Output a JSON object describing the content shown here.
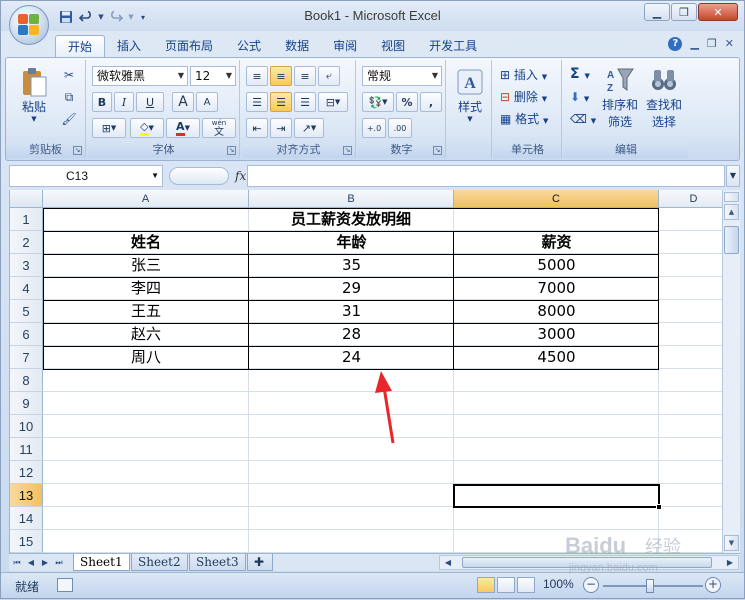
{
  "window": {
    "title": "Book1 - Microsoft Excel"
  },
  "ribbon_tabs": [
    {
      "label": "开始",
      "active": true
    },
    {
      "label": "插入"
    },
    {
      "label": "页面布局"
    },
    {
      "label": "公式"
    },
    {
      "label": "数据"
    },
    {
      "label": "审阅"
    },
    {
      "label": "视图"
    },
    {
      "label": "开发工具"
    }
  ],
  "ribbon": {
    "clipboard": {
      "paste": "粘贴",
      "label": "剪贴板"
    },
    "font": {
      "name": "微软雅黑",
      "size": "12",
      "label": "字体",
      "bold": "B",
      "italic": "I",
      "underline": "U",
      "grow": "A",
      "shrink": "A",
      "color_a": "A",
      "wen": "wén",
      "wen_char": "文"
    },
    "alignment": {
      "label": "对齐方式"
    },
    "number": {
      "format": "常规",
      "percent": "%",
      "comma": ",",
      "inc": "+.0",
      "dec": ".00",
      "label": "数字"
    },
    "styles": {
      "label": "样式"
    },
    "cells": {
      "insert": "插入",
      "delete": "删除",
      "format": "格式",
      "label": "单元格"
    },
    "editing": {
      "sigma": "Σ",
      "sort_filter_1": "排序和",
      "sort_filter_2": "筛选",
      "find_1": "查找和",
      "find_2": "选择",
      "label": "编辑"
    }
  },
  "formula_bar": {
    "name_box": "C13",
    "fx": "fx",
    "value": ""
  },
  "columns": [
    "A",
    "B",
    "C",
    "D"
  ],
  "rows": [
    "1",
    "2",
    "3",
    "4",
    "5",
    "6",
    "7",
    "8",
    "9",
    "10",
    "11",
    "12",
    "13",
    "14",
    "15"
  ],
  "table": {
    "title": "员工薪资发放明细",
    "headers": [
      "姓名",
      "年龄",
      "薪资"
    ],
    "rows": [
      [
        "张三",
        "35",
        "5000"
      ],
      [
        "李四",
        "29",
        "7000"
      ],
      [
        "王五",
        "31",
        "8000"
      ],
      [
        "赵六",
        "28",
        "3000"
      ],
      [
        "周八",
        "24",
        "4500"
      ]
    ]
  },
  "active_cell": "C13",
  "sheets": [
    "Sheet1",
    "Sheet2",
    "Sheet3"
  ],
  "active_sheet": "Sheet1",
  "status": {
    "ready": "就绪",
    "zoom": "100%",
    "minus": "−",
    "plus": "+"
  },
  "watermark": {
    "brand": "Baidu",
    "sub": "经验",
    "url": "jingyan.baidu.com"
  },
  "colors": {
    "accent_orange": "#f1c15f",
    "arrow_red": "#e8272c",
    "ribbon_blue": "#15428b"
  }
}
